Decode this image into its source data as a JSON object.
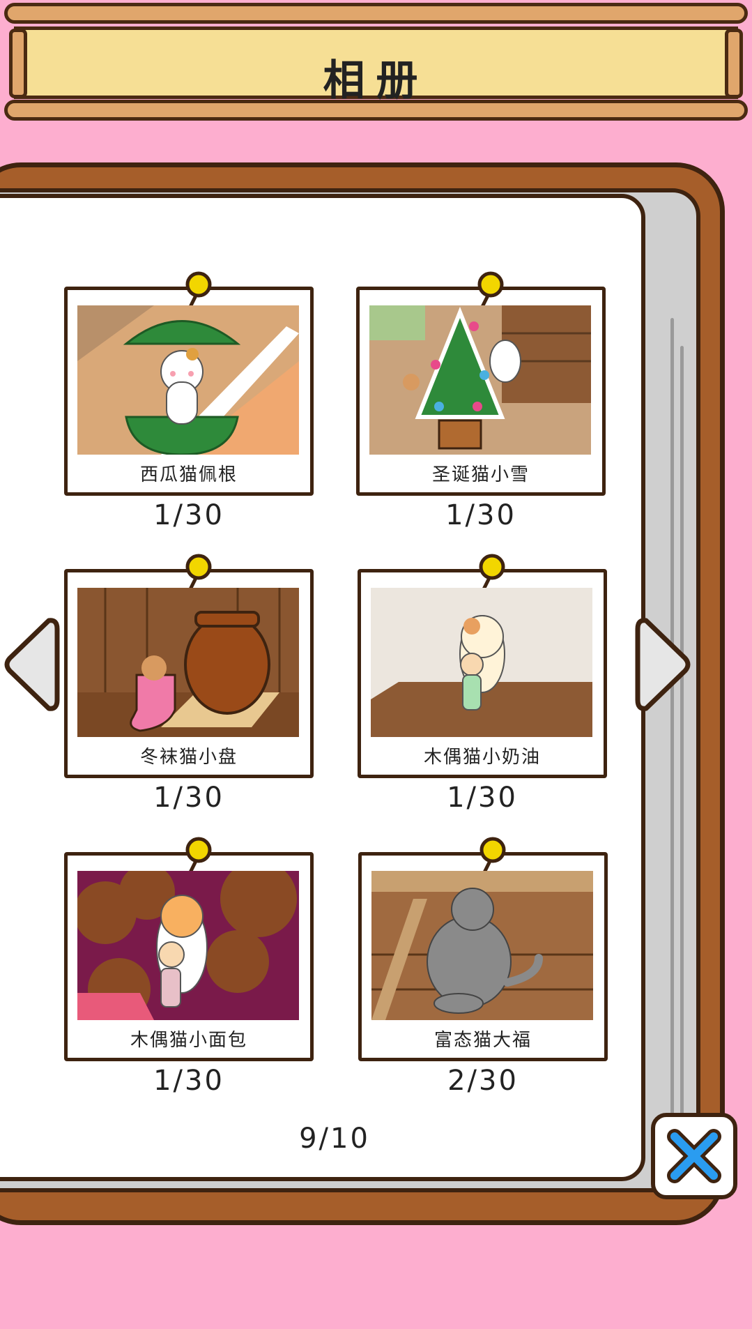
{
  "header": {
    "title": "相册"
  },
  "album": {
    "cards": [
      {
        "name": "西瓜猫佩根",
        "count": "1/30",
        "scene": "watermelon"
      },
      {
        "name": "圣诞猫小雪",
        "count": "1/30",
        "scene": "christmas"
      },
      {
        "name": "冬袜猫小盘",
        "count": "1/30",
        "scene": "sock"
      },
      {
        "name": "木偶猫小奶油",
        "count": "1/30",
        "scene": "puppet-cream"
      },
      {
        "name": "木偶猫小面包",
        "count": "1/30",
        "scene": "puppet-bread"
      },
      {
        "name": "富态猫大福",
        "count": "2/30",
        "scene": "chubby"
      }
    ],
    "page_indicator": "9/10"
  },
  "controls": {
    "prev_icon": "left-triangle-icon",
    "next_icon": "right-triangle-icon",
    "close_icon": "close-x-icon"
  },
  "colors": {
    "background": "#fdaecf",
    "banner": "#f6df95",
    "wood": "#a65e2a",
    "outline": "#3e2310",
    "pin": "#f2d600",
    "close_x": "#2a9cf0"
  }
}
